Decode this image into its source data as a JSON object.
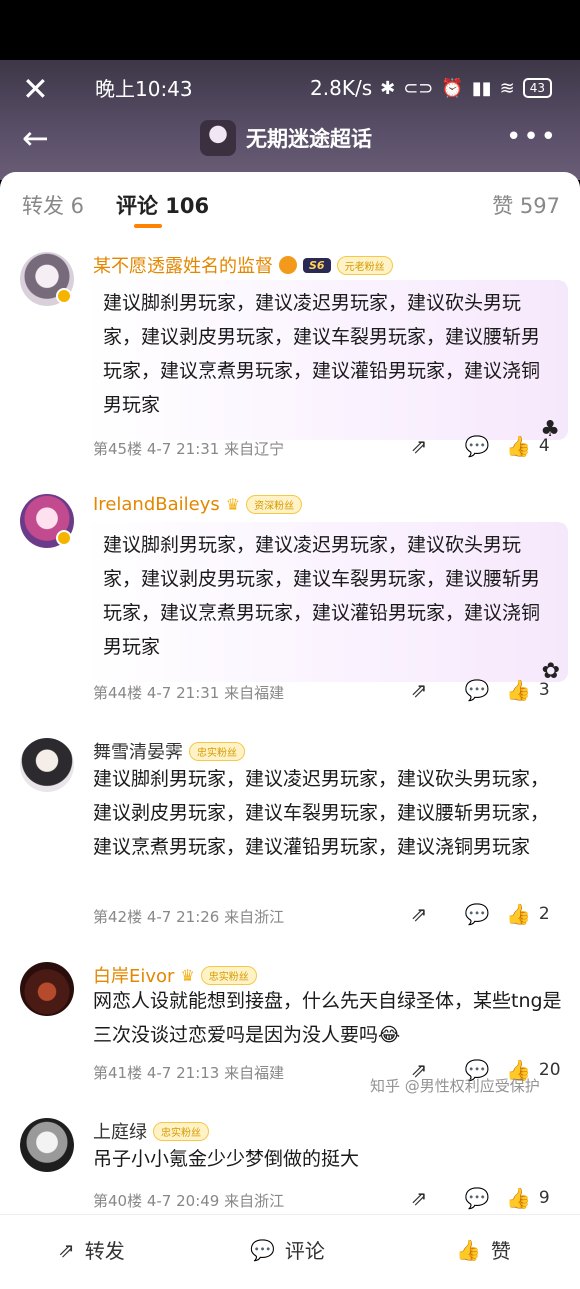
{
  "status_bar": {
    "time": "晚上10:43",
    "speed": "2.8K/s",
    "battery": "43"
  },
  "nav": {
    "title": "无期迷途超话"
  },
  "tabs": {
    "repost": "转发 6",
    "comments": "评论 106",
    "likes": "赞 597"
  },
  "comments": [
    {
      "user": "某不愿透露姓名的监督",
      "level": "S6",
      "fan": "元老粉丝",
      "text": "建议脚刹男玩家，建议凌迟男玩家，建议砍头男玩家，建议剥皮男玩家，建议车裂男玩家，建议腰斩男玩家，建议烹煮男玩家，建议灌铅男玩家，建议浇铜男玩家",
      "meta": "第45楼 4-7 21:31 来自辽宁",
      "likes": "4"
    },
    {
      "user": "IrelandBaileys",
      "fan": "资深粉丝",
      "text": "建议脚刹男玩家，建议凌迟男玩家，建议砍头男玩家，建议剥皮男玩家，建议车裂男玩家，建议腰斩男玩家，建议烹煮男玩家，建议灌铅男玩家，建议浇铜男玩家",
      "meta": "第44楼 4-7 21:31 来自福建",
      "likes": "3"
    },
    {
      "user": "舞雪清晏霁",
      "fan": "忠实粉丝",
      "text": "建议脚刹男玩家，建议凌迟男玩家，建议砍头男玩家，建议剥皮男玩家，建议车裂男玩家，建议腰斩男玩家，建议烹煮男玩家，建议灌铅男玩家，建议浇铜男玩家",
      "meta": "第42楼 4-7 21:26 来自浙江",
      "likes": "2"
    },
    {
      "user": "白岸Eivor",
      "fan": "忠实粉丝",
      "text": "网恋人设就能想到接盘，什么先天自绿圣体，某些tng是三次没谈过恋爱吗是因为没人要吗😂",
      "meta": "第41楼 4-7 21:13 来自福建",
      "likes": "20"
    },
    {
      "user": "上庭绿",
      "fan": "忠实粉丝",
      "text": "吊子小小氪金少少梦倒做的挺大",
      "meta": "第40楼 4-7 20:49 来自浙江",
      "likes": "9"
    }
  ],
  "bottom_bar": {
    "repost": "转发",
    "comment": "评论",
    "like": "赞"
  },
  "watermark": "知乎 @男性权利应受保护"
}
